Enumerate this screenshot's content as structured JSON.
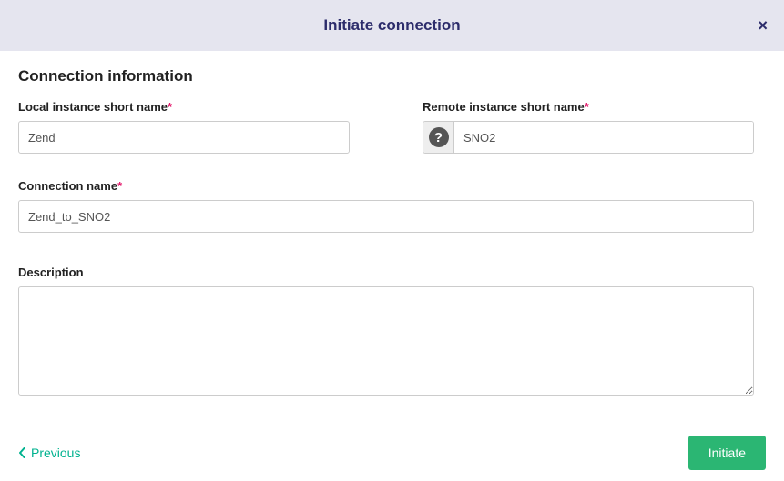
{
  "header": {
    "title": "Initiate connection",
    "close_label": "×"
  },
  "section": {
    "title": "Connection information"
  },
  "fields": {
    "local": {
      "label": "Local instance short name",
      "required": "*",
      "value": "Zend"
    },
    "remote": {
      "label": "Remote instance short name",
      "required": "*",
      "help": "?",
      "value": "SNO2"
    },
    "connection_name": {
      "label": "Connection name",
      "required": "*",
      "value": "Zend_to_SNO2"
    },
    "description": {
      "label": "Description",
      "value": ""
    }
  },
  "footer": {
    "previous": "Previous",
    "initiate": "Initiate"
  }
}
